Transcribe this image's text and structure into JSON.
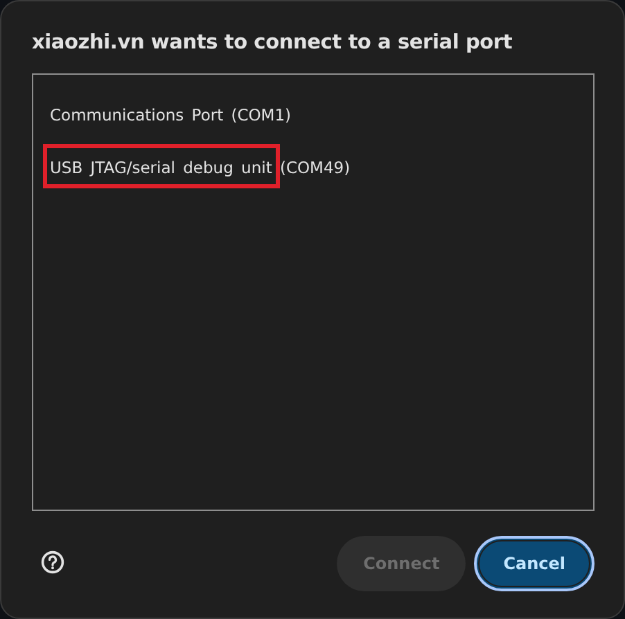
{
  "dialog": {
    "title": "xiaozhi.vn wants to connect to a serial port"
  },
  "ports": [
    {
      "label": "Communications Port (COM1)",
      "selected": false,
      "highlighted": false
    },
    {
      "label": "USB JTAG/serial debug unit (COM49)",
      "selected": false,
      "highlighted": true
    }
  ],
  "buttons": [
    {
      "label": "Connect",
      "kind": "secondary",
      "disabled": true,
      "focused": false
    },
    {
      "label": "Cancel",
      "kind": "primary",
      "disabled": false,
      "focused": true
    }
  ]
}
